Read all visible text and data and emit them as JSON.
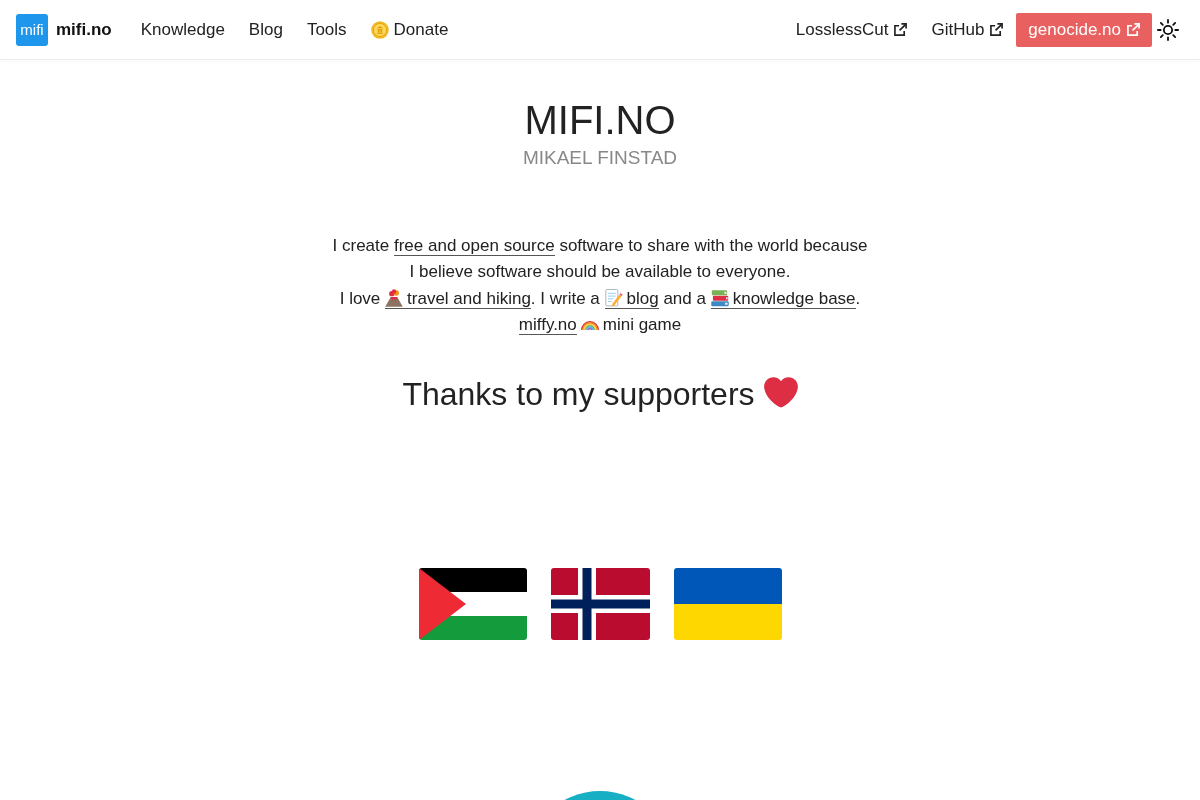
{
  "nav": {
    "logo_text": "mifi",
    "brand": "mifi.no",
    "links": [
      {
        "label": "Knowledge"
      },
      {
        "label": "Blog"
      },
      {
        "label": "Tools"
      },
      {
        "label": "Donate",
        "icon": true
      }
    ],
    "external_links": [
      {
        "label": "LosslessCut",
        "kind": "link"
      },
      {
        "label": "GitHub",
        "kind": "link"
      },
      {
        "label": "genocide.no",
        "kind": "button"
      }
    ]
  },
  "hero": {
    "title": "MIFI.NO",
    "subtitle": "MIKAEL FINSTAD"
  },
  "intro": {
    "paragraphs": [
      {
        "lines": [
          [
            {
              "kind": "text",
              "text": "I create "
            },
            {
              "kind": "link",
              "text": "free and open source"
            },
            {
              "kind": "text",
              "text": " software to share with the world because"
            }
          ],
          [
            {
              "kind": "text",
              "text": "I believe software should be available to everyone."
            }
          ]
        ]
      },
      {
        "lines": [
          [
            {
              "kind": "text",
              "text": "I love "
            },
            {
              "kind": "link",
              "icon": true,
              "text": "travel and hiking"
            },
            {
              "kind": "text",
              "text": ". I write a "
            },
            {
              "kind": "link",
              "icon": true,
              "text": "blog"
            },
            {
              "kind": "text",
              "text": " and a "
            },
            {
              "kind": "link",
              "icon": true,
              "text": "knowledge base"
            },
            {
              "kind": "text",
              "text": "."
            }
          ]
        ]
      },
      {
        "lines": [
          [
            {
              "kind": "link",
              "text": "miffy.no"
            },
            {
              "kind": "text",
              "icon": true,
              "text": "mini game"
            }
          ]
        ]
      }
    ]
  },
  "supporters": {
    "heading": "Thanks to my supporters"
  }
}
